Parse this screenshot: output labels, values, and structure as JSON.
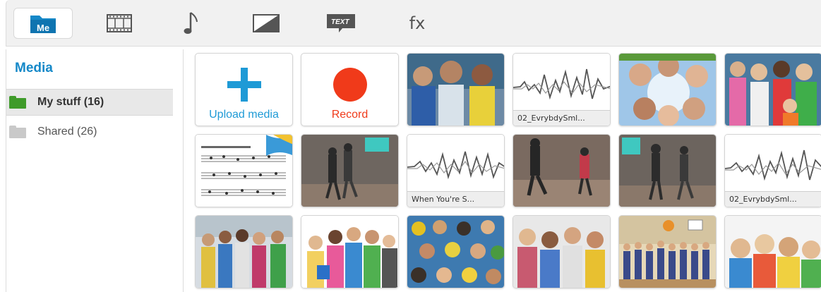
{
  "toolbar": {
    "tabs": [
      {
        "icon": "media-folder-icon",
        "label": "Me",
        "active": true
      },
      {
        "icon": "film-strip-icon",
        "active": false
      },
      {
        "icon": "music-note-icon",
        "active": false
      },
      {
        "icon": "transition-icon",
        "active": false
      },
      {
        "icon": "text-icon",
        "label": "TEXT",
        "active": false
      },
      {
        "icon": "effects-icon",
        "label": "fx",
        "active": false
      }
    ]
  },
  "sidebar": {
    "title": "Media",
    "items": [
      {
        "label": "My stuff (16)",
        "icon": "folder-icon",
        "color": "#3f9b2a",
        "selected": true
      },
      {
        "label": "Shared (26)",
        "icon": "folder-icon",
        "color": "#c9c9c9",
        "selected": false
      }
    ]
  },
  "grid": {
    "actions": [
      {
        "label": "Upload media",
        "icon": "plus-icon",
        "color": "#1e9ad6"
      },
      {
        "label": "Record",
        "icon": "record-dot-icon",
        "color": "#f03a1a"
      }
    ],
    "audio_captions": [
      "02_EvrybdySml...",
      "When You're S...",
      "02_EvrybdySml..."
    ]
  }
}
